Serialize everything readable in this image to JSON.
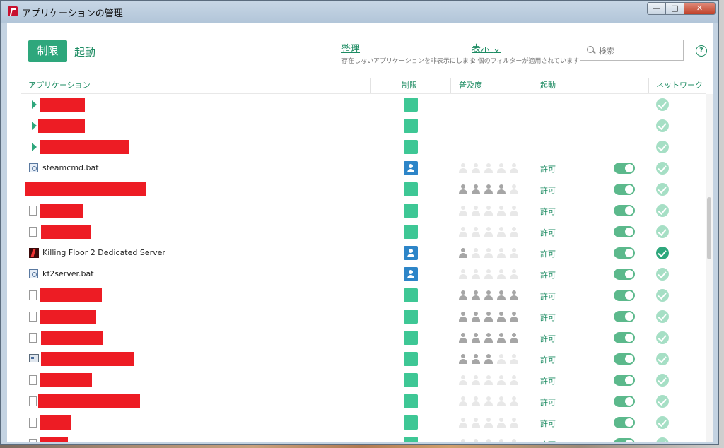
{
  "window": {
    "title": "アプリケーションの管理",
    "controls": {
      "minimize": "—",
      "maximize": "□",
      "close": "✕"
    }
  },
  "header": {
    "restrict_button": "制限",
    "launch_link": "起動",
    "organize": {
      "label": "整理",
      "sub": "存在しないアプリケーションを非表示にします"
    },
    "view": {
      "label": "表示",
      "chevron": "⌄",
      "sub": "2 個のフィルターが適用されています"
    },
    "search": {
      "placeholder": "検索",
      "value": ""
    },
    "help": "?"
  },
  "columns": {
    "application": "アプリケーション",
    "restriction": "制限",
    "popularity": "普及度",
    "launch": "起動",
    "network": "ネットワーク"
  },
  "colors": {
    "accent": "#2ea77c",
    "restricted_user": "#2d85c8",
    "redaction": "#ed1c24"
  },
  "rows": [
    {
      "name": "",
      "icon": "expander",
      "restriction": "trusted",
      "popularity": 0,
      "launch": "",
      "network": "allowed"
    },
    {
      "name": "",
      "icon": "expander",
      "restriction": "trusted",
      "popularity": 0,
      "launch": "",
      "network": "allowed"
    },
    {
      "name": "",
      "icon": "expander",
      "restriction": "trusted",
      "popularity": 0,
      "launch": "",
      "network": "allowed"
    },
    {
      "name": "steamcmd.bat",
      "icon": "gear-file-icon",
      "restriction": "user",
      "popularity": 0,
      "launch": "許可",
      "network": "allowed"
    },
    {
      "name": "",
      "icon": "none",
      "restriction": "trusted",
      "popularity": 4,
      "launch": "許可",
      "network": "allowed"
    },
    {
      "name": "",
      "icon": "file-icon",
      "restriction": "trusted",
      "popularity": 0,
      "launch": "許可",
      "network": "allowed"
    },
    {
      "name": "",
      "icon": "file-icon",
      "restriction": "trusted",
      "popularity": 0,
      "launch": "許可",
      "network": "allowed"
    },
    {
      "name": "Killing Floor 2 Dedicated Server",
      "icon": "kf2-icon",
      "restriction": "user",
      "popularity": 1,
      "launch": "許可",
      "network": "allowed-active"
    },
    {
      "name": "kf2server.bat",
      "icon": "gear-file-icon",
      "restriction": "user",
      "popularity": 0,
      "launch": "許可",
      "network": "allowed"
    },
    {
      "name": "",
      "icon": "file-icon",
      "restriction": "trusted",
      "popularity": 5,
      "launch": "許可",
      "network": "allowed"
    },
    {
      "name": "",
      "icon": "file-icon",
      "restriction": "trusted",
      "popularity": 5,
      "launch": "許可",
      "network": "allowed"
    },
    {
      "name": "",
      "icon": "file-icon",
      "restriction": "trusted",
      "popularity": 5,
      "launch": "許可",
      "network": "allowed"
    },
    {
      "name": "",
      "icon": "window-icon",
      "restriction": "trusted",
      "popularity": 3,
      "launch": "許可",
      "network": "allowed"
    },
    {
      "name": "",
      "icon": "file-icon",
      "restriction": "trusted",
      "popularity": 0,
      "launch": "許可",
      "network": "allowed"
    },
    {
      "name": "",
      "icon": "file-icon",
      "restriction": "trusted",
      "popularity": 0,
      "launch": "許可",
      "network": "allowed"
    },
    {
      "name": "",
      "icon": "file-icon",
      "restriction": "trusted",
      "popularity": 0,
      "launch": "許可",
      "network": "allowed"
    },
    {
      "name": "",
      "icon": "file-icon",
      "restriction": "trusted",
      "popularity": 0,
      "launch": "許可",
      "network": "allowed"
    }
  ]
}
